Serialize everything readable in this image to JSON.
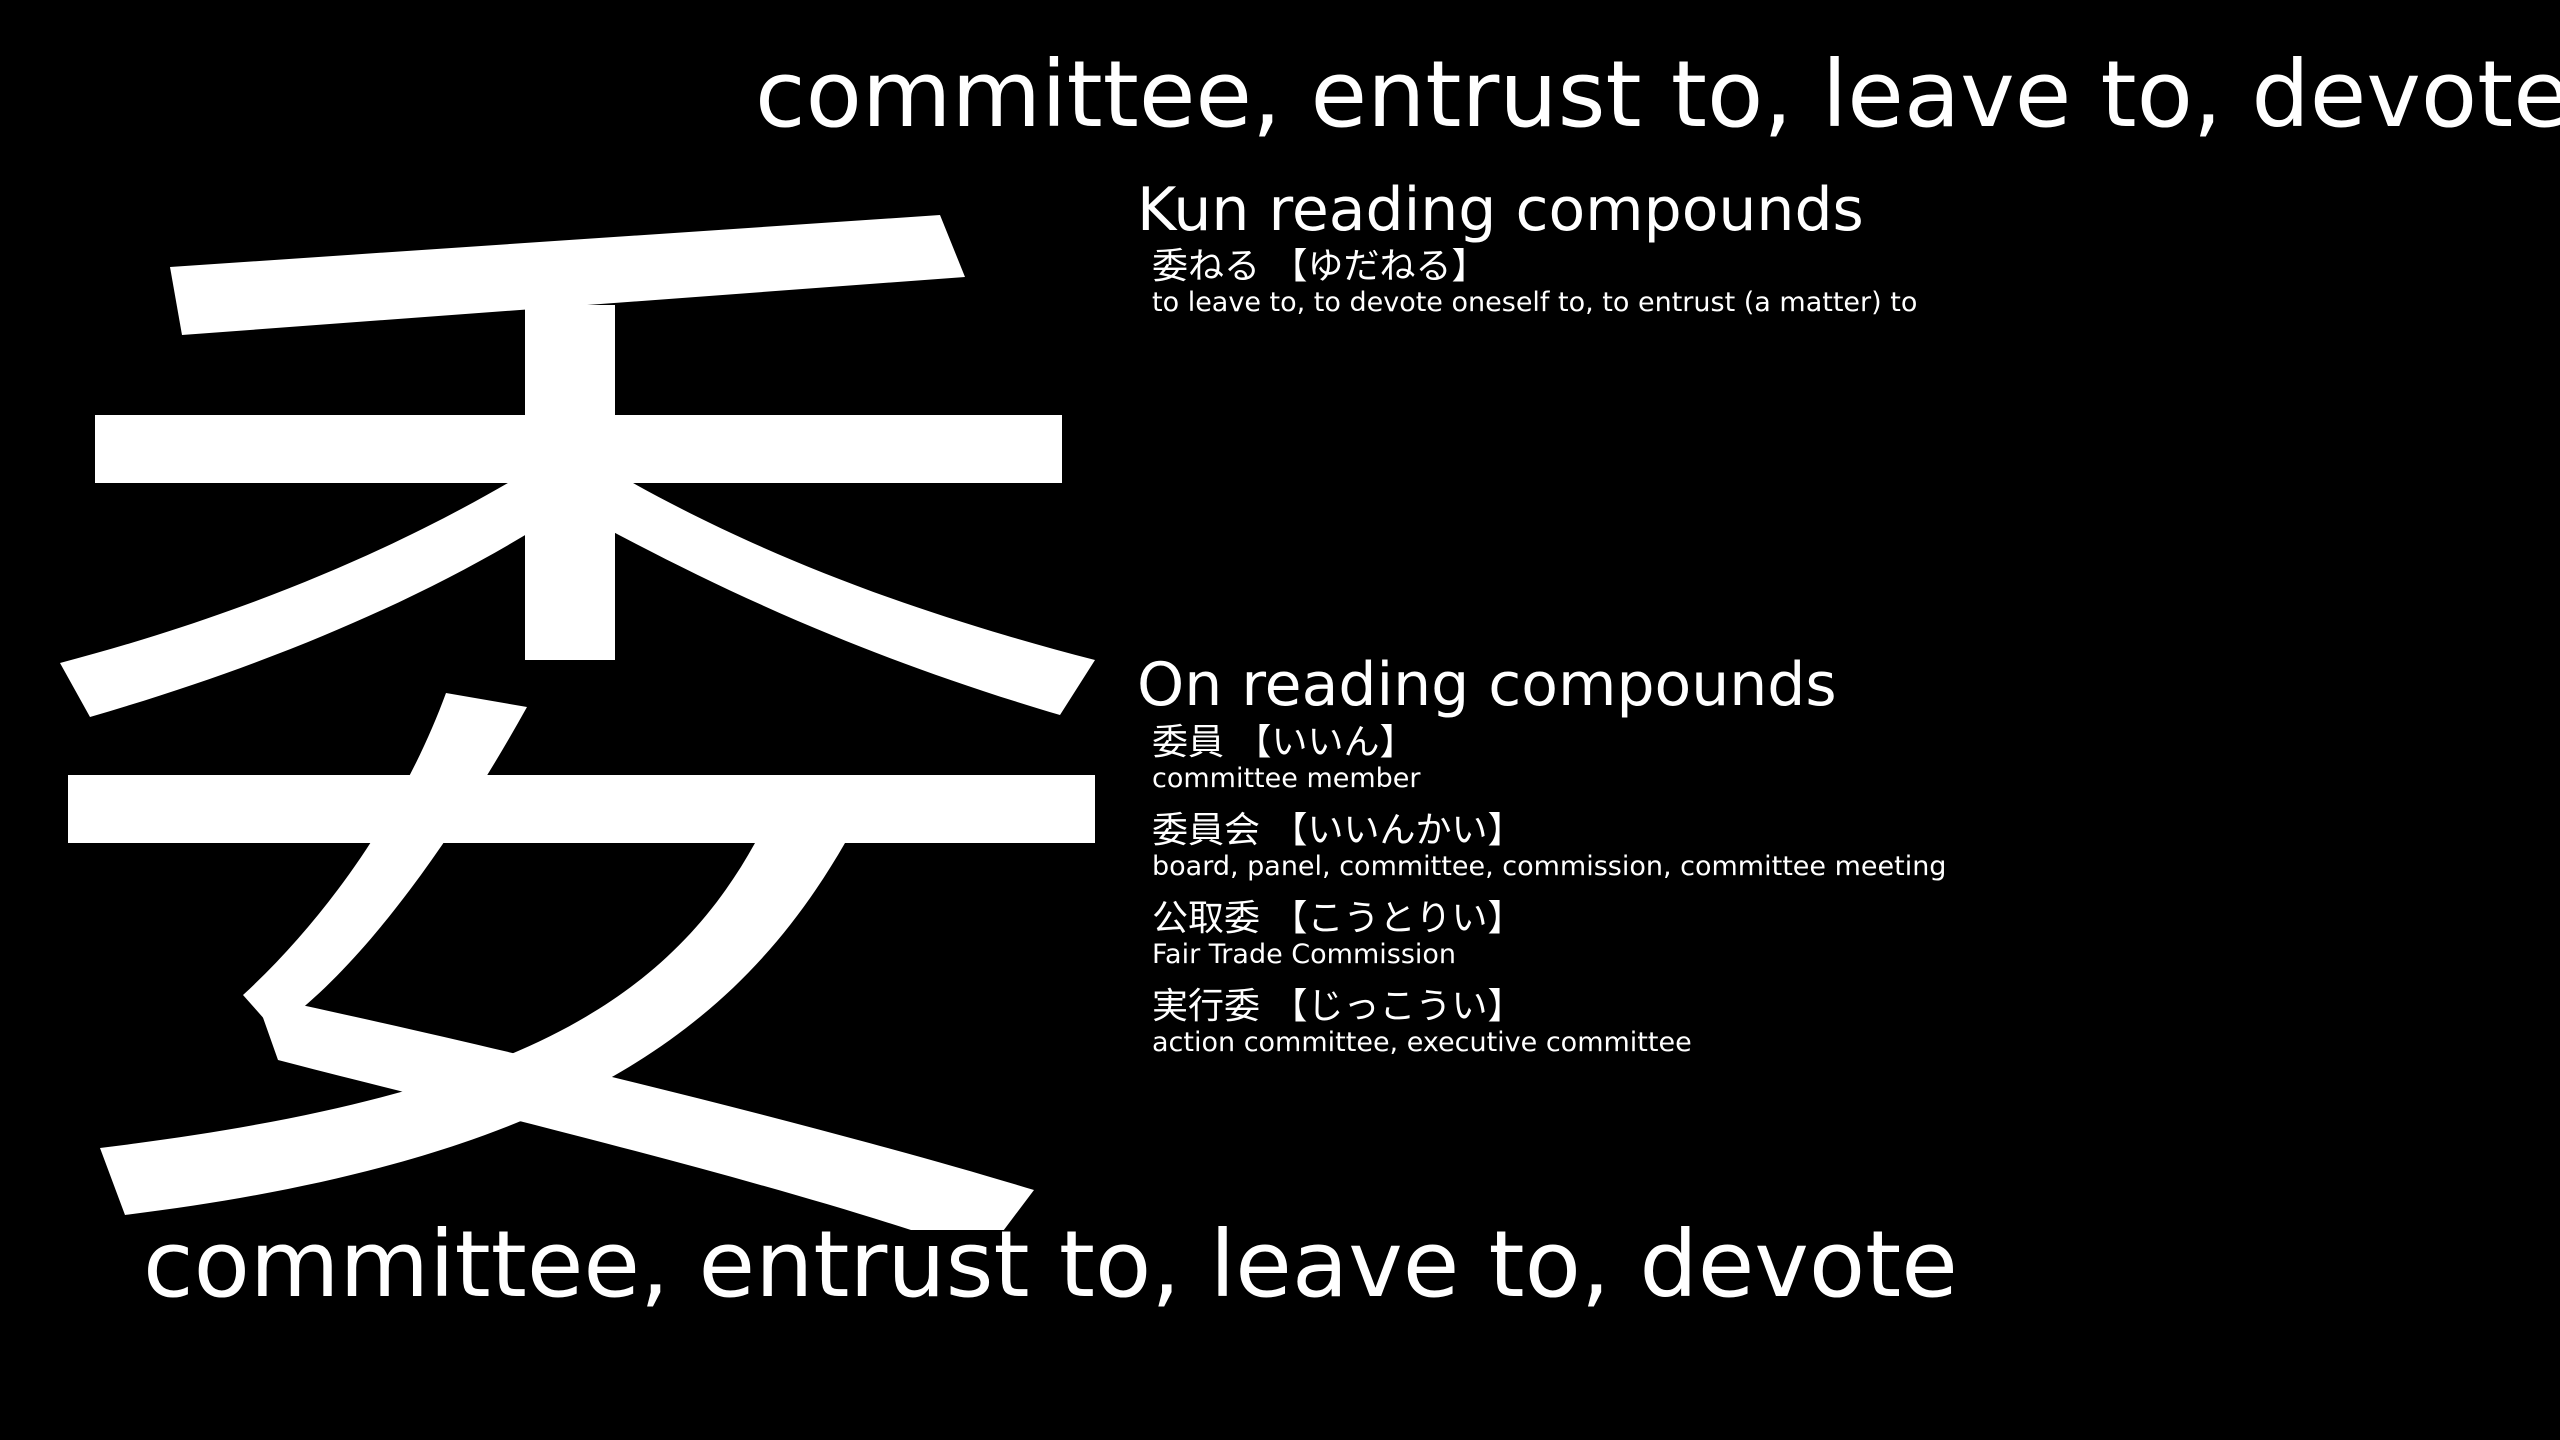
{
  "kanji": "委",
  "meaning": "committee, entrust to, leave to, devote",
  "kun_section": {
    "heading": "Kun reading compounds",
    "compounds": [
      {
        "word": "委ねる 【ゆだねる】",
        "gloss": "to leave to, to devote oneself to, to entrust (a matter) to"
      }
    ]
  },
  "on_section": {
    "heading": "On reading compounds",
    "compounds": [
      {
        "word": "委員 【いいん】",
        "gloss": "committee member"
      },
      {
        "word": "委員会 【いいんかい】",
        "gloss": "board, panel, committee, commission, committee meeting"
      },
      {
        "word": "公取委 【こうとりい】",
        "gloss": "Fair Trade Commission"
      },
      {
        "word": "実行委 【じっこうい】",
        "gloss": "action committee, executive committee"
      }
    ]
  },
  "colors": {
    "background": "#000000",
    "foreground": "#ffffff"
  }
}
